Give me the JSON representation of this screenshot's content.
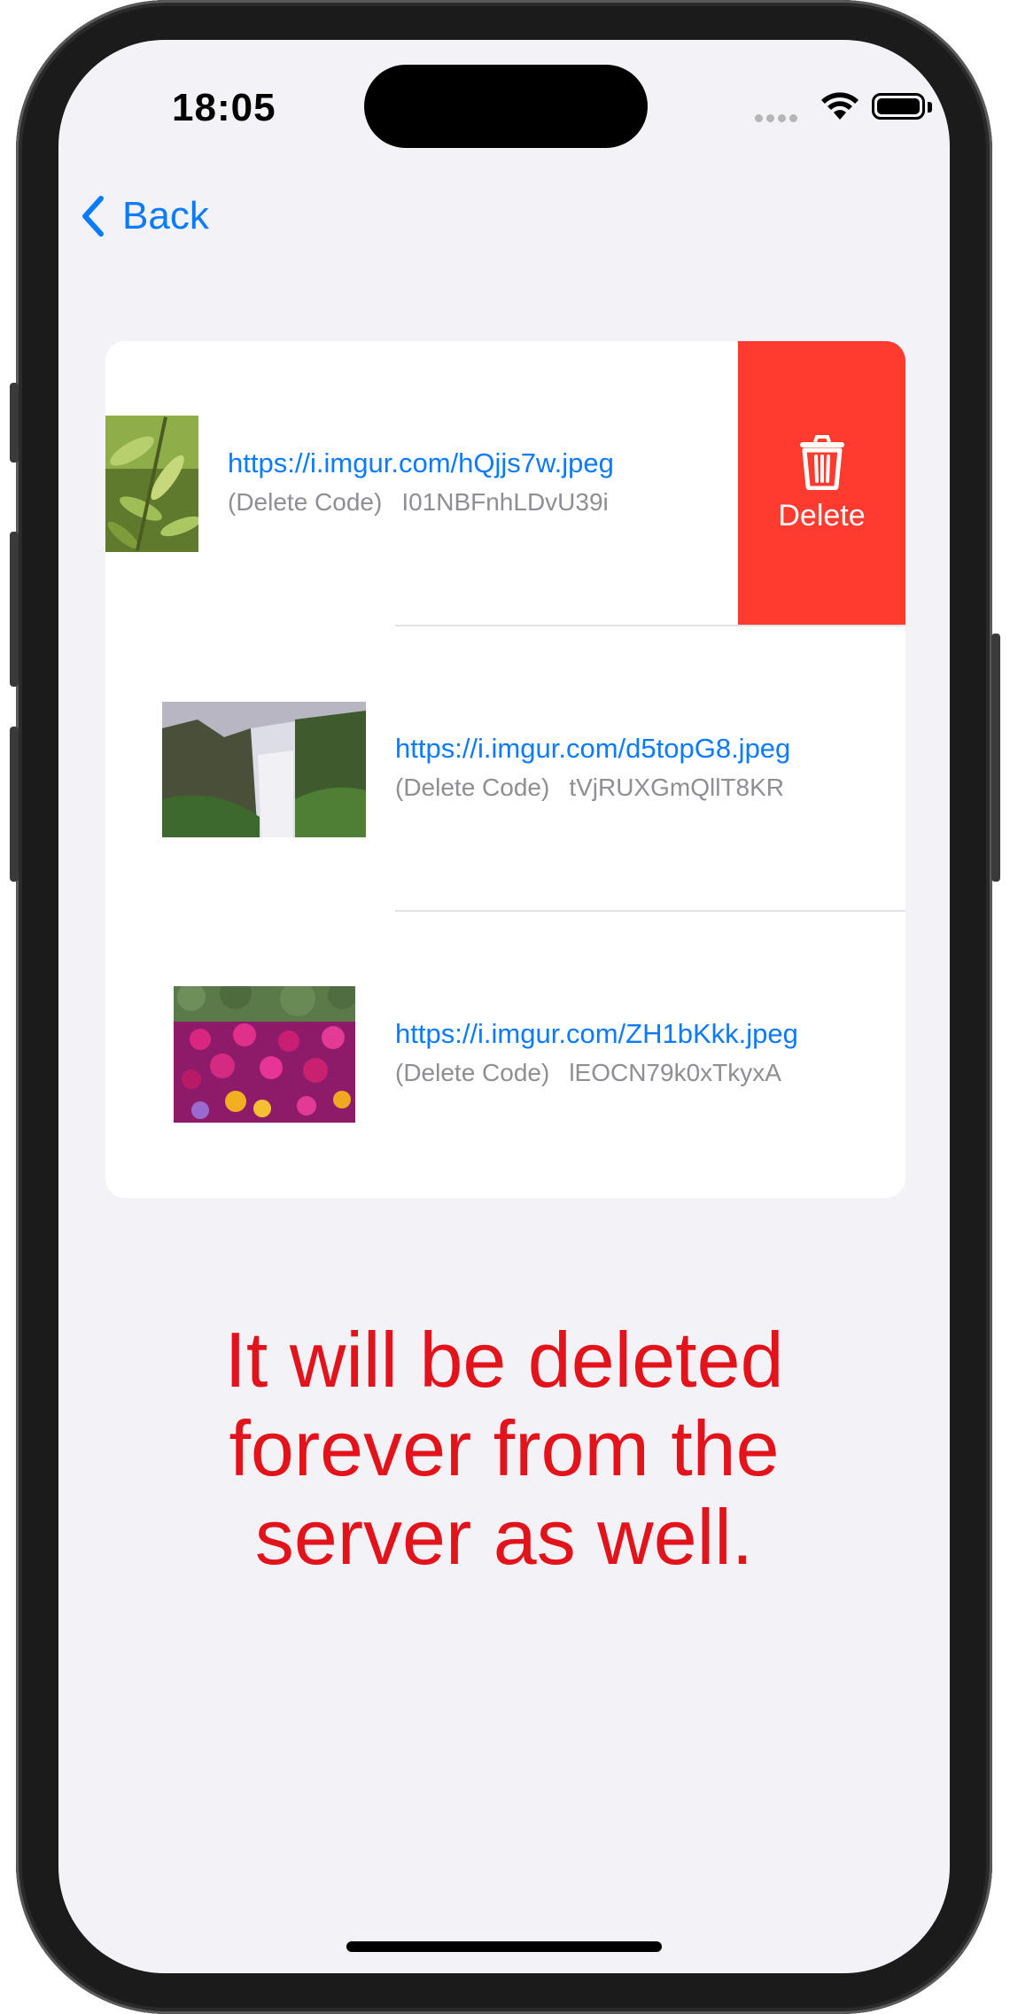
{
  "status_bar": {
    "time": "18:05"
  },
  "nav": {
    "back_label": "Back"
  },
  "list": [
    {
      "url": "https://i.imgur.com/hQjjs7w.jpeg",
      "code_label": "(Delete Code)",
      "code": "I01NBFnhLDvU39i"
    },
    {
      "url": "https://i.imgur.com/d5topG8.jpeg",
      "code_label": "(Delete Code)",
      "code": "tVjRUXGmQllT8KR"
    },
    {
      "url": "https://i.imgur.com/ZH1bKkk.jpeg",
      "code_label": "(Delete Code)",
      "code": "lEOCN79k0xTkyxA"
    }
  ],
  "swipe_action": {
    "label": "Delete",
    "icon": "trash-icon",
    "color": "#ff3b30"
  },
  "warning_lines": [
    "It will be deleted",
    "forever from the",
    "server as well."
  ],
  "colors": {
    "accent": "#0a7aff",
    "warning": "#e3131b",
    "background": "#f2f2f7"
  }
}
